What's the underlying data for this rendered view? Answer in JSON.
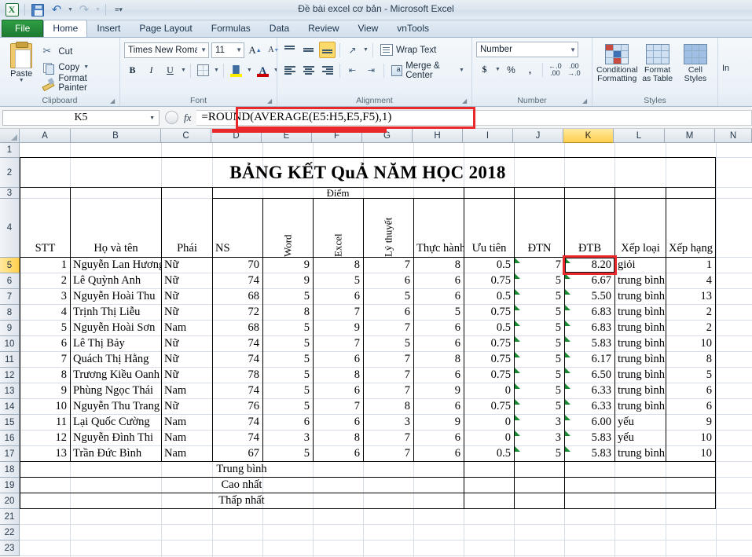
{
  "window": {
    "title": "Đề bài excel cơ bản  -  Microsoft Excel",
    "quick_access": [
      "save-icon",
      "undo-icon",
      "redo-icon",
      "customize-qat-icon"
    ]
  },
  "ribbon": {
    "tabs": [
      {
        "label": "File",
        "kind": "file"
      },
      {
        "label": "Home",
        "kind": "active"
      },
      {
        "label": "Insert",
        "kind": "normal"
      },
      {
        "label": "Page Layout",
        "kind": "normal"
      },
      {
        "label": "Formulas",
        "kind": "normal"
      },
      {
        "label": "Data",
        "kind": "normal"
      },
      {
        "label": "Review",
        "kind": "normal"
      },
      {
        "label": "View",
        "kind": "normal"
      },
      {
        "label": "vnTools",
        "kind": "normal"
      }
    ],
    "clipboard": {
      "group_label": "Clipboard",
      "paste_label": "Paste",
      "cut_label": "Cut",
      "copy_label": "Copy",
      "format_painter_label": "Format Painter"
    },
    "font": {
      "group_label": "Font",
      "font_family": "Times New Roman",
      "font_size": "11",
      "grow_font": "A",
      "shrink_font": "A",
      "bold": "B",
      "italic": "I",
      "underline": "U"
    },
    "alignment": {
      "group_label": "Alignment",
      "wrap_text_label": "Wrap Text",
      "merge_center_label": "Merge & Center"
    },
    "number": {
      "group_label": "Number",
      "format": "Number",
      "currency": "$",
      "percent": "%",
      "comma": ",",
      "increase_decimal": ".00",
      "decrease_decimal": ".00"
    },
    "styles": {
      "group_label": "Styles",
      "conditional_formatting": "Conditional\nFormatting",
      "conditional_formatting_l1": "Conditional",
      "conditional_formatting_l2": "Formatting",
      "format_as_table_l1": "Format",
      "format_as_table_l2": "as Table",
      "cell_styles_l1": "Cell",
      "cell_styles_l2": "Styles",
      "cells_partial": "In"
    }
  },
  "formula_bar": {
    "name_box": "K5",
    "fx_label": "fx",
    "formula": "=ROUND(AVERAGE(E5:H5,E5,F5),1)",
    "highlight_color": "#e8282a"
  },
  "sheet": {
    "column_headers": [
      "A",
      "B",
      "C",
      "D",
      "E",
      "F",
      "G",
      "H",
      "I",
      "J",
      "K",
      "L",
      "M",
      "N"
    ],
    "selected_column": "K",
    "selected_row": "5",
    "row_headers": [
      "1",
      "2",
      "3",
      "4",
      "5",
      "6",
      "7",
      "8",
      "9",
      "10",
      "11",
      "12",
      "13",
      "14",
      "15",
      "16",
      "17",
      "18",
      "19",
      "20",
      "21",
      "22",
      "23"
    ],
    "title": "BẢNG KẾT QuẢ NĂM HỌC 2018",
    "group_header_diem": "Điểm",
    "headers": {
      "stt": "STT",
      "ho_va_ten": "Họ và tên",
      "phai": "Phái",
      "ns": "NS",
      "word": "Word",
      "excel": "Excel",
      "ly_thuyet": "Lý thuyết",
      "thuc_hanh": "Thực hành",
      "uu_tien": "Ưu tiên",
      "dtn": "ĐTN",
      "dtb": "ĐTB",
      "xep_loai": "Xếp loại",
      "xep_hang": "Xếp hạng"
    },
    "rows": [
      {
        "stt": "1",
        "ten": "Nguyễn Lan Hương",
        "phai": "Nữ",
        "ns": "70",
        "word": "9",
        "excel": "8",
        "ly": "7",
        "th": "8",
        "ut": "0.5",
        "dtn": "7",
        "dtb": "8.20",
        "xl": "giỏi",
        "xh": "1"
      },
      {
        "stt": "2",
        "ten": "Lê Quỳnh Anh",
        "phai": "Nữ",
        "ns": "74",
        "word": "9",
        "excel": "5",
        "ly": "6",
        "th": "6",
        "ut": "0.75",
        "dtn": "5",
        "dtb": "6.67",
        "xl": "trung bình",
        "xh": "4"
      },
      {
        "stt": "3",
        "ten": "Nguyễn Hoài Thu",
        "phai": "Nữ",
        "ns": "68",
        "word": "5",
        "excel": "6",
        "ly": "5",
        "th": "6",
        "ut": "0.5",
        "dtn": "5",
        "dtb": "5.50",
        "xl": "trung bình",
        "xh": "13"
      },
      {
        "stt": "4",
        "ten": "Trịnh Thị Liễu",
        "phai": "Nữ",
        "ns": "72",
        "word": "8",
        "excel": "7",
        "ly": "6",
        "th": "5",
        "ut": "0.75",
        "dtn": "5",
        "dtb": "6.83",
        "xl": "trung bình",
        "xh": "2"
      },
      {
        "stt": "5",
        "ten": "Nguyễn Hoài Sơn",
        "phai": "Nam",
        "ns": "68",
        "word": "5",
        "excel": "9",
        "ly": "7",
        "th": "6",
        "ut": "0.5",
        "dtn": "5",
        "dtb": "6.83",
        "xl": "trung bình",
        "xh": "2"
      },
      {
        "stt": "6",
        "ten": "Lê Thị Bảy",
        "phai": "Nữ",
        "ns": "74",
        "word": "5",
        "excel": "7",
        "ly": "5",
        "th": "6",
        "ut": "0.75",
        "dtn": "5",
        "dtb": "5.83",
        "xl": "trung bình",
        "xh": "10"
      },
      {
        "stt": "7",
        "ten": "Quách Thị Hằng",
        "phai": "Nữ",
        "ns": "74",
        "word": "5",
        "excel": "6",
        "ly": "7",
        "th": "8",
        "ut": "0.75",
        "dtn": "5",
        "dtb": "6.17",
        "xl": "trung bình",
        "xh": "8"
      },
      {
        "stt": "8",
        "ten": "Trương Kiều Oanh",
        "phai": "Nữ",
        "ns": "78",
        "word": "5",
        "excel": "8",
        "ly": "7",
        "th": "6",
        "ut": "0.75",
        "dtn": "5",
        "dtb": "6.50",
        "xl": "trung bình",
        "xh": "5"
      },
      {
        "stt": "9",
        "ten": "Phùng Ngọc Thái",
        "phai": "Nam",
        "ns": "74",
        "word": "5",
        "excel": "6",
        "ly": "7",
        "th": "9",
        "ut": "0",
        "dtn": "5",
        "dtb": "6.33",
        "xl": "trung bình",
        "xh": "6"
      },
      {
        "stt": "10",
        "ten": "Nguyễn Thu Trang",
        "phai": "Nữ",
        "ns": "76",
        "word": "5",
        "excel": "7",
        "ly": "8",
        "th": "6",
        "ut": "0.75",
        "dtn": "5",
        "dtb": "6.33",
        "xl": "trung bình",
        "xh": "6"
      },
      {
        "stt": "11",
        "ten": "Lại Quốc Cường",
        "phai": "Nam",
        "ns": "74",
        "word": "6",
        "excel": "6",
        "ly": "3",
        "th": "9",
        "ut": "0",
        "dtn": "3",
        "dtb": "6.00",
        "xl": "yếu",
        "xh": "9"
      },
      {
        "stt": "12",
        "ten": "Nguyễn Đình Thi",
        "phai": "Nam",
        "ns": "74",
        "word": "3",
        "excel": "8",
        "ly": "7",
        "th": "6",
        "ut": "0",
        "dtn": "3",
        "dtb": "5.83",
        "xl": "yếu",
        "xh": "10"
      },
      {
        "stt": "13",
        "ten": "Trần Đức Bình",
        "phai": "Nam",
        "ns": "67",
        "word": "5",
        "excel": "6",
        "ly": "7",
        "th": "6",
        "ut": "0.5",
        "dtn": "5",
        "dtb": "5.83",
        "xl": "trung bình",
        "xh": "10"
      }
    ],
    "summary_rows": [
      {
        "label": "Trung bình"
      },
      {
        "label": "Cao nhất"
      },
      {
        "label": "Thấp nhất"
      }
    ],
    "active_cell_value": "8.20"
  }
}
